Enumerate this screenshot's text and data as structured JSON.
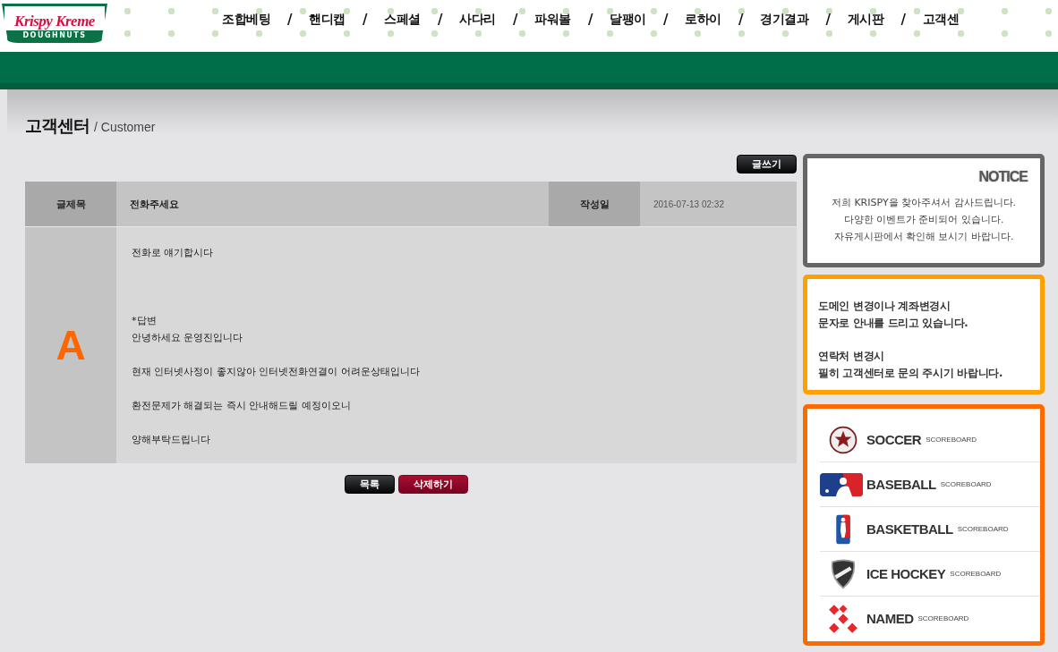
{
  "logo": {
    "wordmark": "Krispy Kreme",
    "tagline": "DOUGHNUTS"
  },
  "nav": [
    {
      "label": "조합베팅",
      "separator": "/"
    },
    {
      "label": "핸디캡",
      "separator": "/"
    },
    {
      "label": "스페셜",
      "separator": "/"
    },
    {
      "label": "사다리",
      "separator": "/"
    },
    {
      "label": "파워볼",
      "separator": "/"
    },
    {
      "label": "달팽이",
      "separator": "/"
    },
    {
      "label": "로하이",
      "separator": "/"
    },
    {
      "label": "경기결과",
      "separator": "/"
    },
    {
      "label": "게시판",
      "separator": "/"
    },
    {
      "label": "고객센"
    }
  ],
  "page_title": {
    "title": "고객센터",
    "subtitle": "/ Customer"
  },
  "write_button": "글쓰기",
  "post": {
    "title_label": "글제목",
    "title": "전화주세요",
    "date_label": "작성일",
    "date": "2016-07-13 02:32",
    "answer_mark": "A",
    "paragraphs": [
      [
        "전화로 얘기합시다"
      ],
      [
        "*답변",
        "안녕하세요 운영진입니다"
      ],
      [
        "현재 인터넷사정이 좋지않아 인터넷전화연결이 어려운상태입니다"
      ],
      [
        "환전문제가 해결되는 즉시 안내해드릴 예정이오니"
      ],
      [
        "양해부탁드립니다"
      ]
    ]
  },
  "actions": [
    {
      "label": "목록",
      "kind": "list"
    },
    {
      "label": "삭제하기",
      "kind": "delete"
    }
  ],
  "notice": {
    "heading": "NOTICE",
    "lines": [
      "저희 KRISPY을 찾아주셔서 감사드립니다.",
      "다양한 이벤트가 준비되어 있습니다.",
      "자유게시판에서 확인해 보시기 바랍니다."
    ]
  },
  "info": [
    [
      "도메인 변경이나 계좌변경시",
      "문자로 안내를 드리고 있습니다."
    ],
    [
      "연락처 변경시",
      "필히 고객센터로 문의 주시기 바랍니다."
    ]
  ],
  "scoreboards": [
    {
      "name": "SOCCER",
      "suffix": "SCOREBOARD",
      "kind": "soccer"
    },
    {
      "name": "BASEBALL",
      "suffix": "SCOREBOARD",
      "kind": "baseball"
    },
    {
      "name": "BASKETBALL",
      "suffix": "SCOREBOARD",
      "kind": "basketball"
    },
    {
      "name": "ICE HOCKEY",
      "suffix": "SCOREBOARD",
      "kind": "hockey"
    },
    {
      "name": "NAMED",
      "suffix": "SCOREBOARD",
      "kind": "named"
    }
  ]
}
